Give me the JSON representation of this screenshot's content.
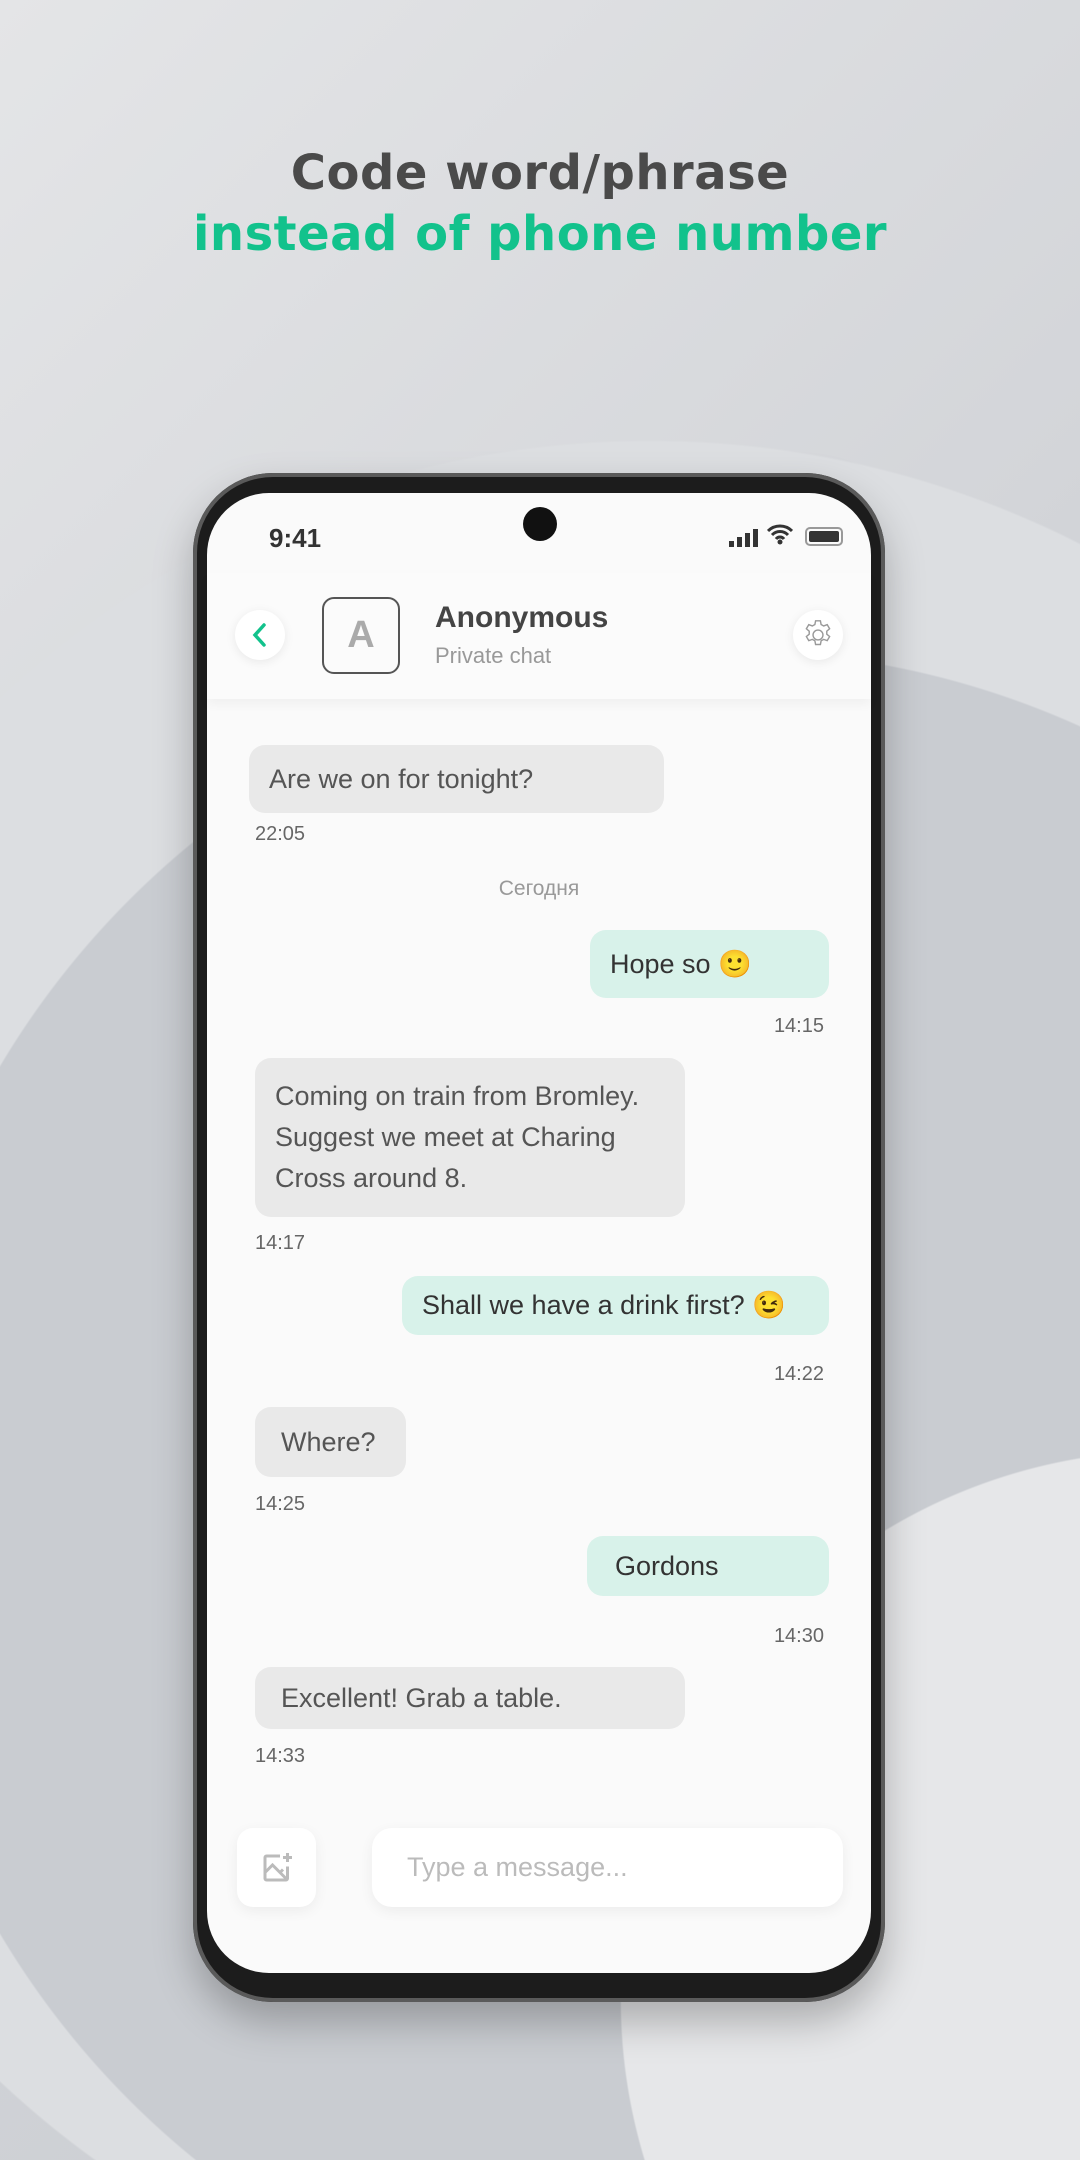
{
  "headline": {
    "line1": "Code word/phrase",
    "line2": "instead of phone number",
    "line1_color": "#4a4a4a",
    "line2_color": "#12c28c"
  },
  "status_bar": {
    "time": "9:41",
    "icons": [
      "signal-icon",
      "wifi-icon",
      "battery-icon"
    ]
  },
  "header": {
    "avatar_letter": "A",
    "name": "Anonymous",
    "subtitle": "Private chat",
    "back_icon": "chevron-left-icon",
    "settings_icon": "gear-icon",
    "accent": "#12c28c"
  },
  "date_separator": "Сегодня",
  "messages": [
    {
      "dir": "in",
      "text": "Are we on for tonight?",
      "time": "22:05"
    },
    {
      "dir": "out",
      "text": "Hope so 🙂",
      "time": "14:15"
    },
    {
      "dir": "in",
      "text": "Coming on train from Bromley. Suggest we meet at Charing Cross around 8.",
      "time": "14:17"
    },
    {
      "dir": "out",
      "text": "Shall we have a drink first? 😉",
      "time": "14:22"
    },
    {
      "dir": "in",
      "text": "Where?",
      "time": "14:25"
    },
    {
      "dir": "out",
      "text": "Gordons",
      "time": "14:30"
    },
    {
      "dir": "in",
      "text": "Excellent! Grab a table.",
      "time": "14:33"
    }
  ],
  "composer": {
    "placeholder": "Type a message...",
    "attach_icon": "image-add-icon"
  }
}
